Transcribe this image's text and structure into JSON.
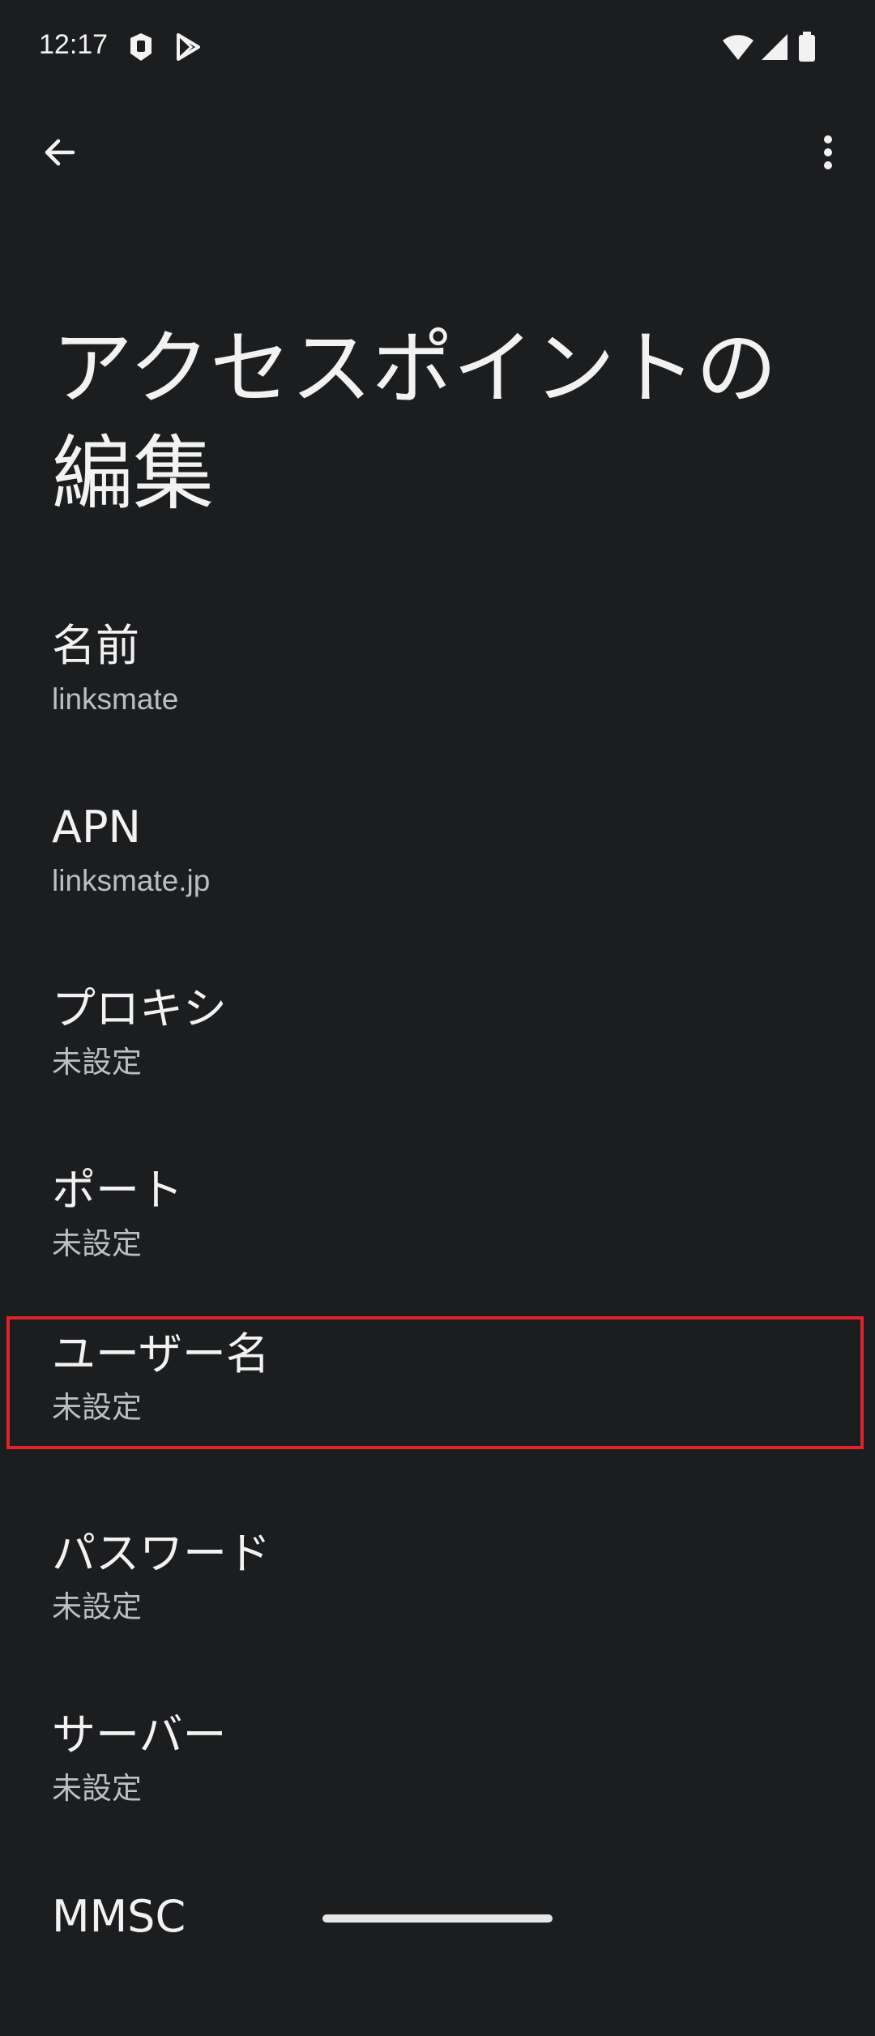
{
  "status_bar": {
    "time": "12:17",
    "icons": [
      "assistant-icon",
      "play-store-icon",
      "wifi-icon",
      "signal-icon",
      "battery-icon"
    ]
  },
  "toolbar": {
    "back_icon": "back-arrow-icon",
    "menu_icon": "more-vert-icon"
  },
  "page_title": "アクセスポイントの編集",
  "items": [
    {
      "title": "名前",
      "summary": "linksmate"
    },
    {
      "title": "APN",
      "summary": "linksmate.jp"
    },
    {
      "title": "プロキシ",
      "summary": "未設定"
    },
    {
      "title": "ポート",
      "summary": "未設定"
    },
    {
      "title": "ユーザー名",
      "summary": "未設定"
    },
    {
      "title": "パスワード",
      "summary": "未設定"
    },
    {
      "title": "サーバー",
      "summary": "未設定"
    },
    {
      "title": "MMSC",
      "summary": ""
    }
  ],
  "colors": {
    "background": "#1c1d1f",
    "highlight": "#e0222b"
  }
}
